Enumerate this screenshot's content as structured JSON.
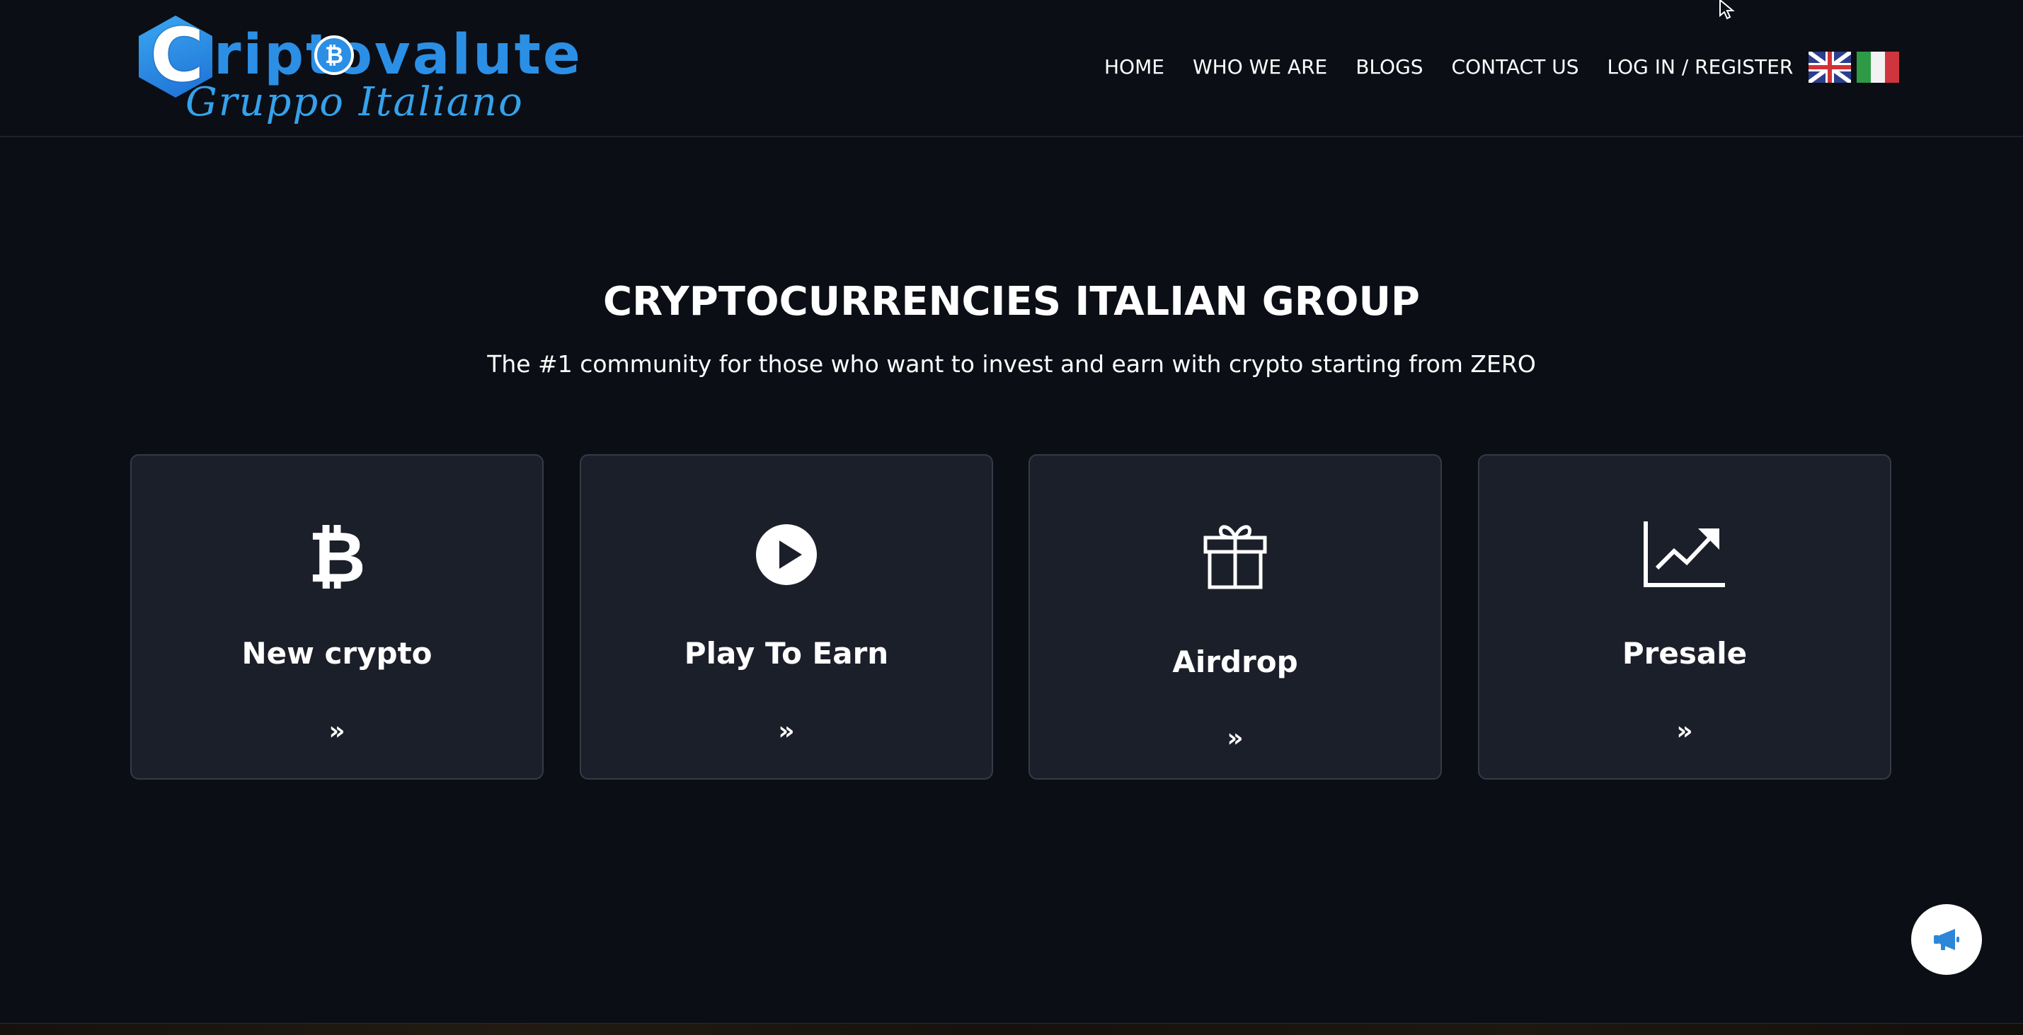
{
  "logo": {
    "c": "C",
    "word": "riptovalute",
    "btc": "₿",
    "tagline": "Gruppo Italiano"
  },
  "nav": {
    "items": [
      "HOME",
      "WHO WE ARE",
      "BLOGS",
      "CONTACT US",
      "LOG IN / REGISTER"
    ],
    "flags": [
      "uk-flag-icon",
      "italy-flag-icon"
    ]
  },
  "hero": {
    "title": "CRYPTOCURRENCIES ITALIAN GROUP",
    "subtitle": "The #1 community for those who want to invest and earn with crypto starting from ZERO"
  },
  "cards": [
    {
      "title": "New crypto",
      "icon": "bitcoin-icon",
      "arrow": "»"
    },
    {
      "title": "Play To Earn",
      "icon": "play-circle-icon",
      "arrow": "»"
    },
    {
      "title": "Airdrop",
      "icon": "gift-icon",
      "arrow": "»"
    },
    {
      "title": "Presale",
      "icon": "chart-line-icon",
      "arrow": "»"
    }
  ],
  "fab": {
    "icon": "megaphone-icon"
  },
  "colors": {
    "background": "#0b0e15",
    "card": "#1b1f29",
    "card_border": "#353a46",
    "brand_blue": "#2b8fe6",
    "fab_icon": "#2e86d6"
  }
}
